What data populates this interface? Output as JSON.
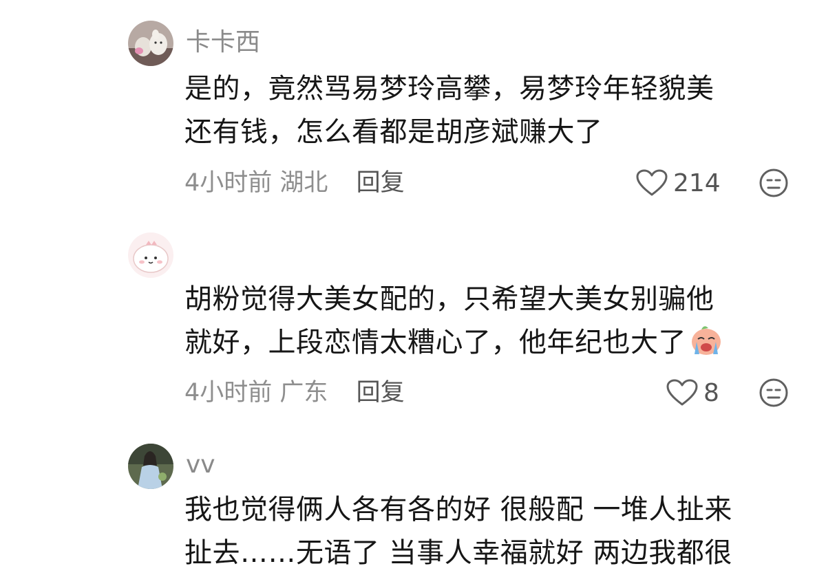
{
  "comments": [
    {
      "username": "卡卡西",
      "lines": [
        "是的，竟然骂易梦玲高攀，易梦玲年轻貌美",
        "还有钱，怎么看都是胡彦斌赚大了"
      ],
      "time": "4小时前",
      "location": "湖北",
      "reply_label": "回复",
      "likes": "214"
    },
    {
      "username": "",
      "lines": [
        "胡粉觉得大美女配的，只希望大美女别骗他",
        "就好，上段恋情太糟心了，他年纪也大了"
      ],
      "time": "4小时前",
      "location": "广东",
      "reply_label": "回复",
      "likes": "8"
    },
    {
      "username": "vv",
      "lines": [
        "我也觉得俩人各有各的好 很般配 一堆人扯来",
        "扯去……无语了 当事人幸福就好 两边我都很"
      ]
    }
  ]
}
